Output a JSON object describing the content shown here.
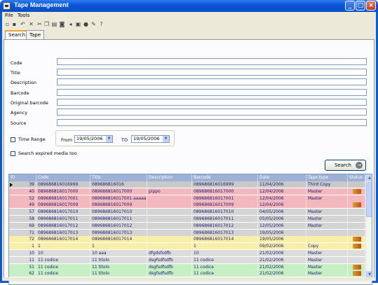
{
  "window": {
    "title": "Tape Management"
  },
  "menu": {
    "file": "File",
    "tools": "Tools"
  },
  "toolbar": {
    "icons": [
      "new-icon",
      "save-icon",
      "undo-icon",
      "delete-icon",
      "cut-icon",
      "copy-icon",
      "print-icon",
      "preview-icon",
      "back-icon",
      "lock-icon",
      "refresh-icon",
      "settings-icon",
      "help-icon"
    ]
  },
  "tabs": {
    "search": "Search",
    "tape": "Tape"
  },
  "form": {
    "code_label": "Code",
    "title_label": "Title",
    "description_label": "Description",
    "barcode_label": "Barcode",
    "original_barcode_label": "Original barcode",
    "agency_label": "Agency",
    "source_label": "Source",
    "time_range_label": "Time Range",
    "from_label": "From",
    "to_label": "TO",
    "from_date": "19/05/2006",
    "to_date": "19/05/2006",
    "expired_label": "Search expired media too",
    "search_button": "Search"
  },
  "grid": {
    "columns": [
      "ID",
      "Code",
      "Title",
      "Description",
      "Barcode",
      "Date",
      "Tape type",
      "Status"
    ],
    "rows": [
      {
        "id": "39",
        "code": "089686816016999",
        "title": "089686816016",
        "description": "",
        "barcode": "089686816016999",
        "date": "11/04/2006",
        "tape_type": "Third Copy",
        "status_icon": false,
        "color": "#c9c9c9",
        "pointer": true
      },
      {
        "id": "40",
        "code": "089686816017000",
        "title": "089686816017000",
        "description": "pippo",
        "barcode": "089686816017000",
        "date": "12/04/2006",
        "tape_type": "Master",
        "status_icon": true,
        "color": "#f3b7be",
        "pointer": false
      },
      {
        "id": "52",
        "code": "089686816017001",
        "title": "089686816017001 aaaaaa",
        "description": "",
        "barcode": "089686816017001",
        "date": "12/04/2006",
        "tape_type": "Master",
        "status_icon": false,
        "color": "#f3b7be",
        "pointer": false
      },
      {
        "id": "49",
        "code": "089686816017009",
        "title": "089686816017009",
        "description": "",
        "barcode": "089686816017009",
        "date": "12/04/2006",
        "tape_type": "",
        "status_icon": true,
        "color": "#f3b7be",
        "pointer": false
      },
      {
        "id": "57",
        "code": "089686816017010",
        "title": "089686816017010",
        "description": "",
        "barcode": "089686816017010",
        "date": "04/05/2006",
        "tape_type": "Master",
        "status_icon": false,
        "color": "#d4d4d4",
        "pointer": false
      },
      {
        "id": "58",
        "code": "089686816017011",
        "title": "089686816017011",
        "description": "",
        "barcode": "089686816017011",
        "date": "05/05/2006",
        "tape_type": "Master",
        "status_icon": false,
        "color": "#d4d4d4",
        "pointer": false
      },
      {
        "id": "69",
        "code": "089686816017012",
        "title": "089686816017012",
        "description": "",
        "barcode": "089686816017012",
        "date": "12/05/2006",
        "tape_type": "Master",
        "status_icon": false,
        "color": "#d4d4d4",
        "pointer": false
      },
      {
        "id": "71",
        "code": "089686816017013",
        "title": "089686816017013",
        "description": "",
        "barcode": "089686816017013",
        "date": "19/05/2006",
        "tape_type": "",
        "status_icon": false,
        "color": "#d4d4d4",
        "pointer": false
      },
      {
        "id": "72",
        "code": "089686816017014",
        "title": "089686816017014",
        "description": "",
        "barcode": "089686816017014",
        "date": "19/05/2006",
        "tape_type": "",
        "status_icon": true,
        "color": "#f8eea8",
        "pointer": false
      },
      {
        "id": "1",
        "code": "1",
        "title": "1",
        "description": "",
        "barcode": "1",
        "date": "09/02/2006",
        "tape_type": "Copy",
        "status_icon": true,
        "color": "#f8eea8",
        "pointer": false
      },
      {
        "id": "10",
        "code": "10",
        "title": "10 aaa",
        "description": "dfgdsfsdfb",
        "barcode": "10",
        "date": "21/02/2006",
        "tape_type": "Master",
        "status_icon": false,
        "color": "#dcdcdc",
        "pointer": false
      },
      {
        "id": "11",
        "code": "11 codice",
        "title": "11 titolo",
        "description": "dsgfsdfsdfb",
        "barcode": "11 codice",
        "date": "21/02/2006",
        "tape_type": "Master",
        "status_icon": false,
        "color": "#dcdcdc",
        "pointer": false
      },
      {
        "id": "51",
        "code": "11 codice",
        "title": "11 titolo",
        "description": "dsgfsdfsdfb",
        "barcode": "11 codice",
        "date": "21/02/2006",
        "tape_type": "Master",
        "status_icon": true,
        "color": "#c6efc6",
        "pointer": false
      },
      {
        "id": "62",
        "code": "11 codice",
        "title": "11 titolo",
        "description": "dsgfsdfsdfb",
        "barcode": "11 codice",
        "date": "21/02/2006",
        "tape_type": "Master",
        "status_icon": true,
        "color": "#c6efc6",
        "pointer": false
      }
    ]
  }
}
